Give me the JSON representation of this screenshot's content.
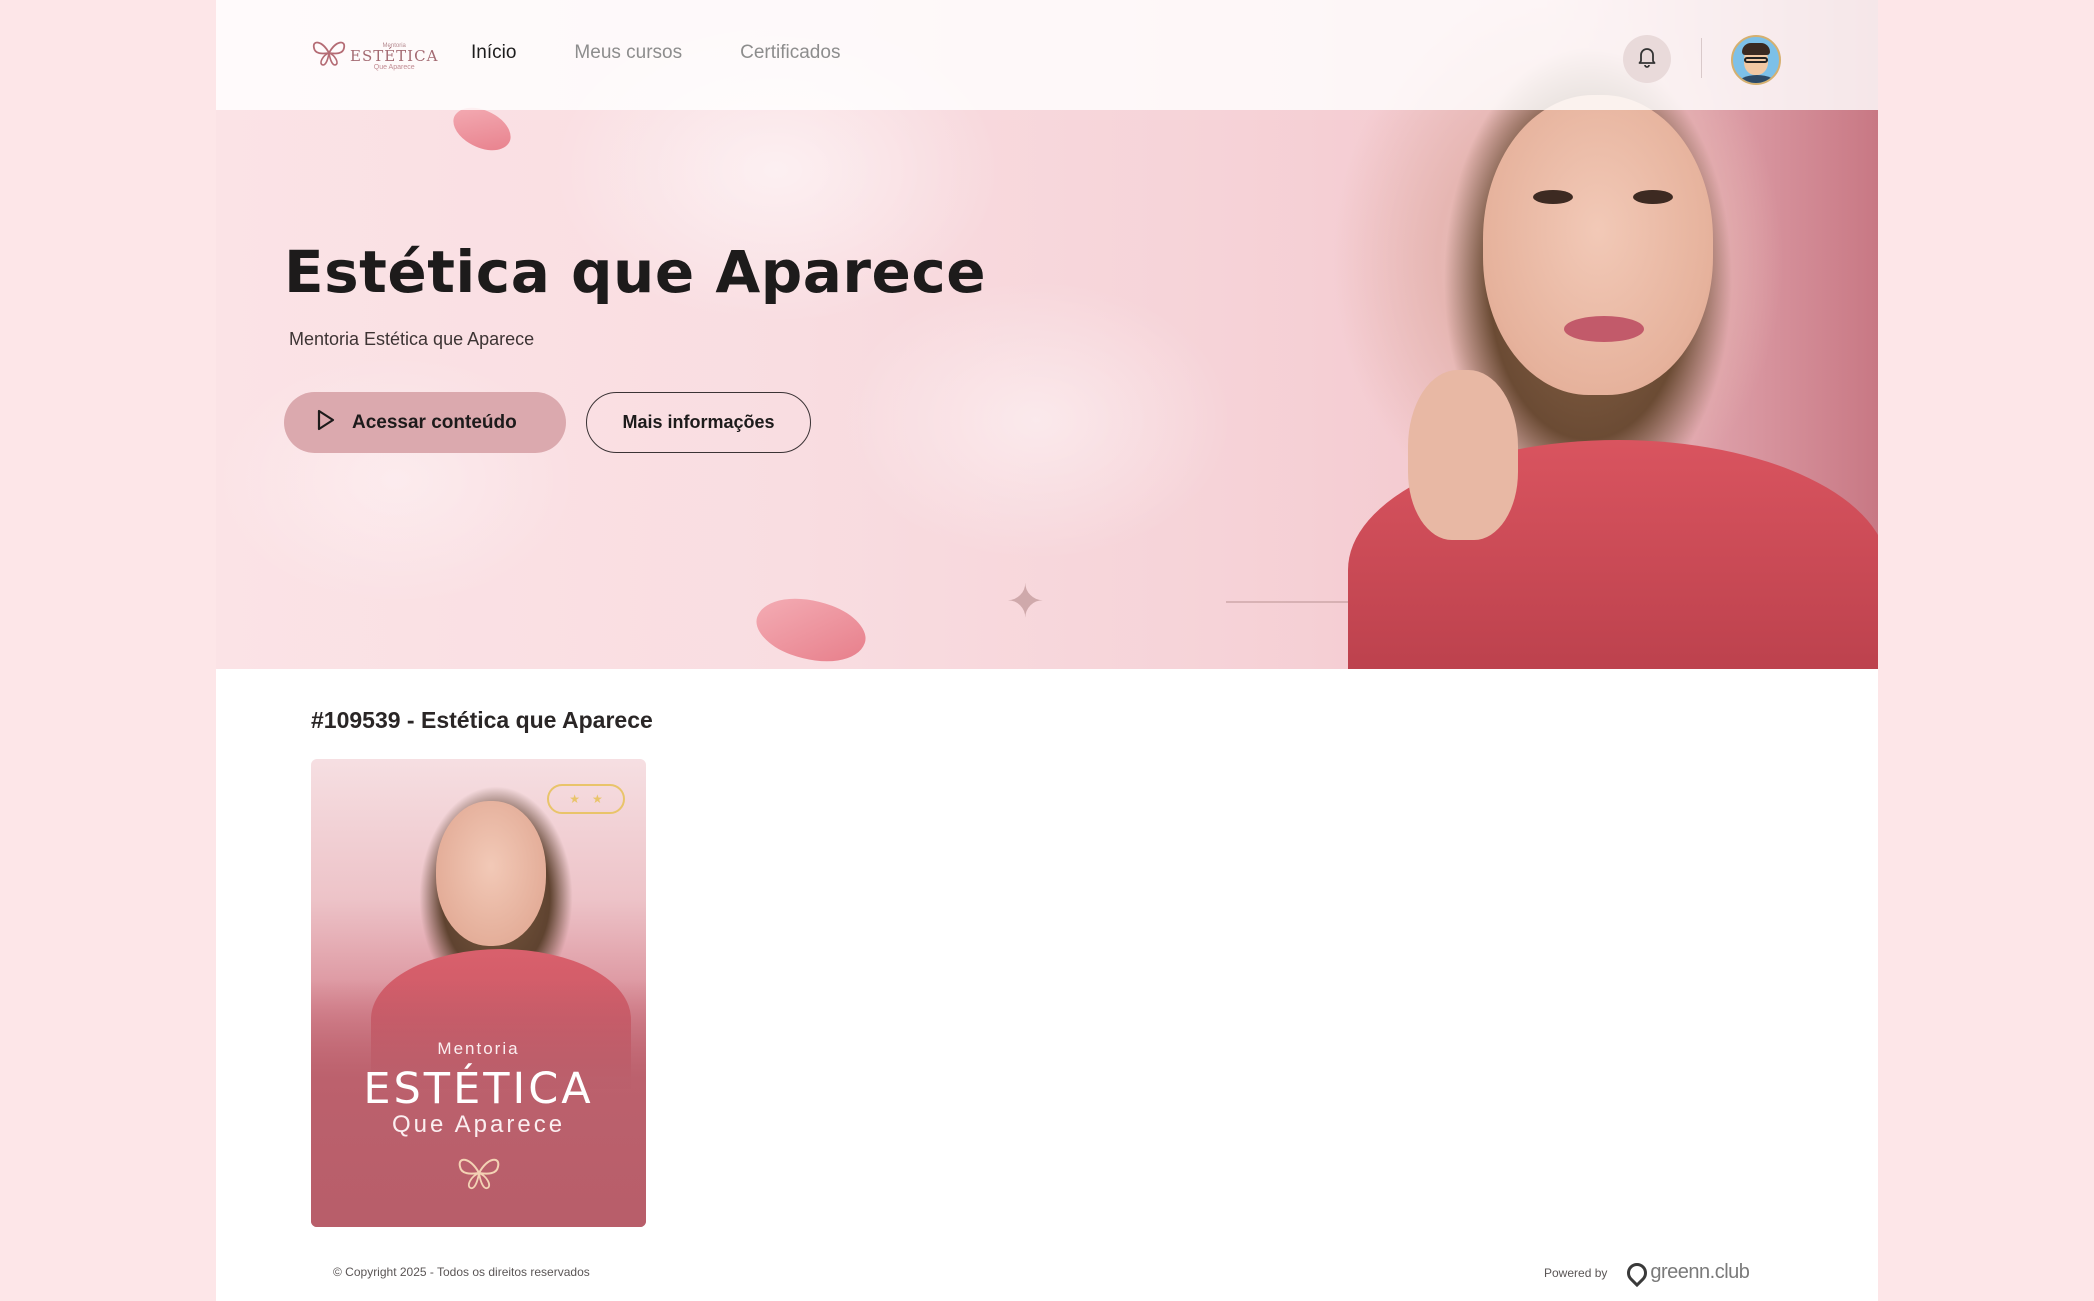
{
  "header": {
    "logo": {
      "top": "Mentoria",
      "name": "ESTÉTICA",
      "bottom": "Que Aparece"
    },
    "nav": [
      {
        "label": "Início",
        "active": true
      },
      {
        "label": "Meus cursos",
        "active": false
      },
      {
        "label": "Certificados",
        "active": false
      }
    ],
    "icons": {
      "notifications": "bell-icon",
      "avatar": "user-avatar"
    }
  },
  "hero": {
    "title": "Estética que Aparece",
    "subtitle": "Mentoria Estética que Aparece",
    "primary_button": "Acessar conteúdo",
    "secondary_button": "Mais informações"
  },
  "course_section": {
    "title": "#109539 - Estética que Aparece",
    "card": {
      "line1": "Mentoria",
      "line2": "ESTÉTICA",
      "line3": "Que Aparece"
    }
  },
  "footer": {
    "copyright": "© Copyright 2025 - Todos os direitos reservados",
    "powered_by": "Powered by",
    "brand": "greenn.club"
  },
  "colors": {
    "page_bg": "#fde6e8",
    "primary_button": "#dba9ae",
    "card_accent": "#b85e6a"
  }
}
